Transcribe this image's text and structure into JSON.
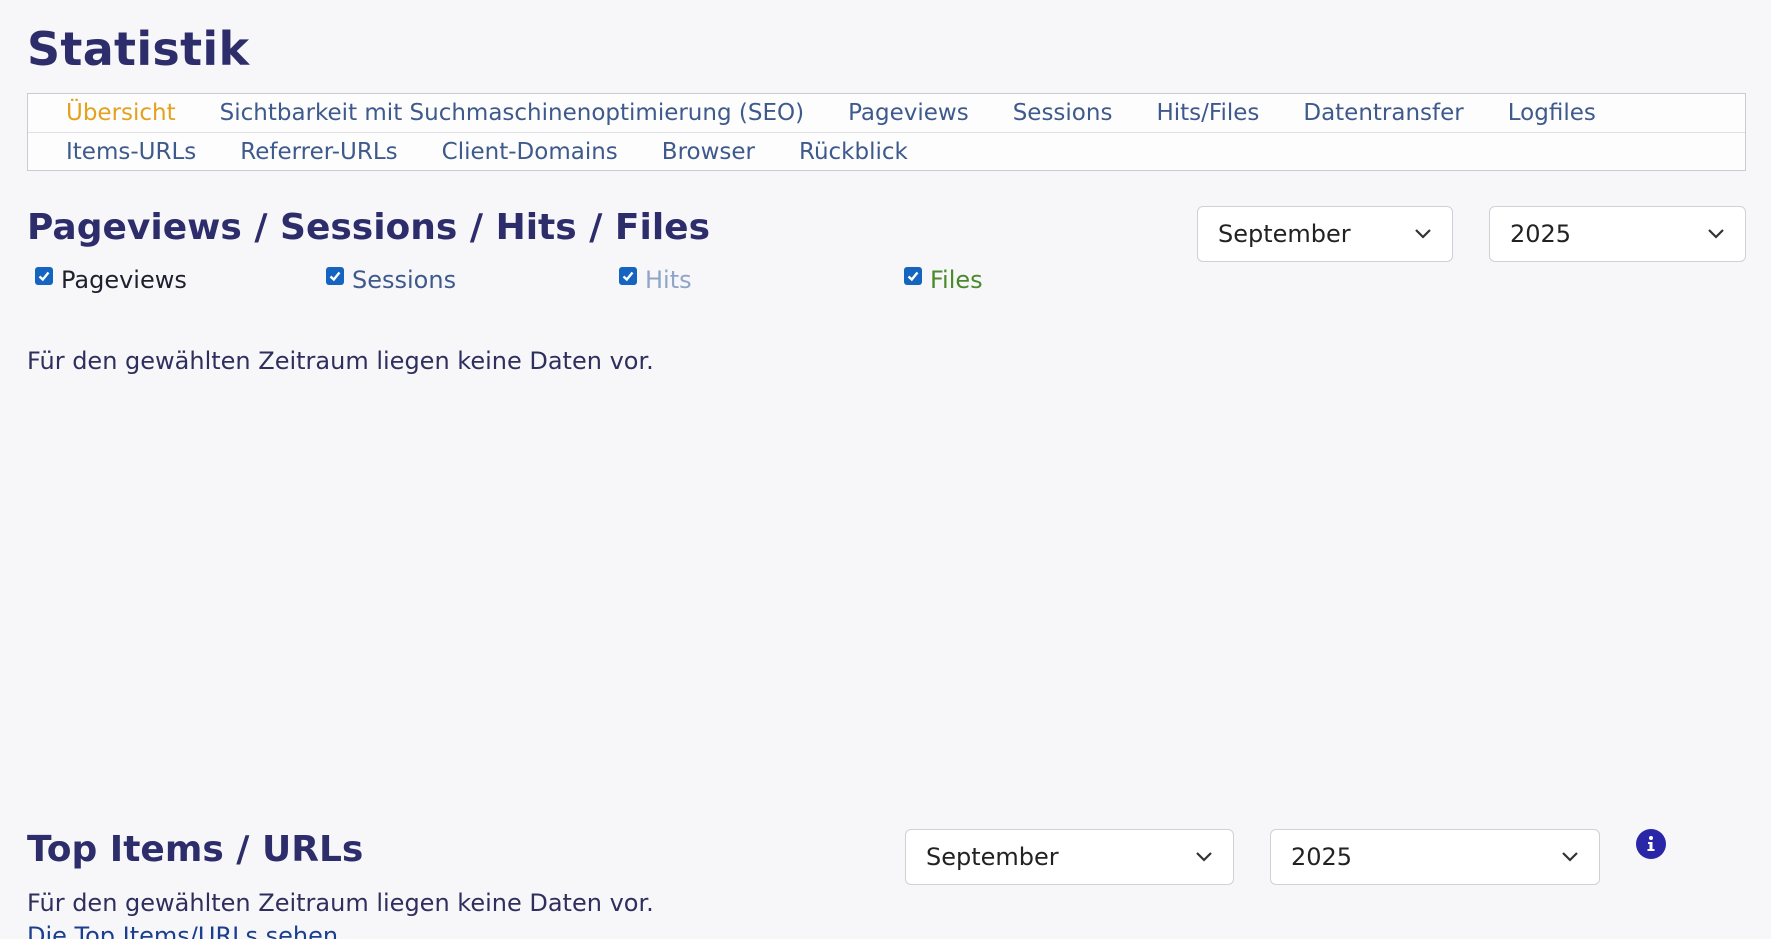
{
  "page": {
    "title": "Statistik"
  },
  "tabs": {
    "row1": [
      "Übersicht",
      "Sichtbarkeit mit Suchmaschinenoptimierung (SEO)",
      "Pageviews",
      "Sessions",
      "Hits/Files",
      "Datentransfer",
      "Logfiles"
    ],
    "row2": [
      "Items-URLs",
      "Referrer-URLs",
      "Client-Domains",
      "Browser",
      "Rückblick"
    ],
    "active": "Übersicht"
  },
  "overview": {
    "title": "Pageviews / Sessions / Hits / Files",
    "month": "September",
    "year": "2025",
    "checkboxes": [
      {
        "label": "Pageviews",
        "checked": true,
        "color": "#1f1f2e"
      },
      {
        "label": "Sessions",
        "checked": true,
        "color": "#3e5a8c"
      },
      {
        "label": "Hits",
        "checked": true,
        "color": "#8fa5c8"
      },
      {
        "label": "Files",
        "checked": true,
        "color": "#4a8a2a"
      }
    ],
    "empty_message": "Für den gewählten Zeitraum liegen keine Daten vor."
  },
  "top_items": {
    "title": "Top Items / URLs",
    "month": "September",
    "year": "2025",
    "empty_message": "Für den gewählten Zeitraum liegen keine Daten vor.",
    "link": "Die Top Items/URLs sehen"
  },
  "colors": {
    "accent": "#e3a11c",
    "title": "#2e2d6b",
    "link": "#3e5a8c",
    "checkbox": "#1565c0",
    "info": "#2a26a8"
  }
}
